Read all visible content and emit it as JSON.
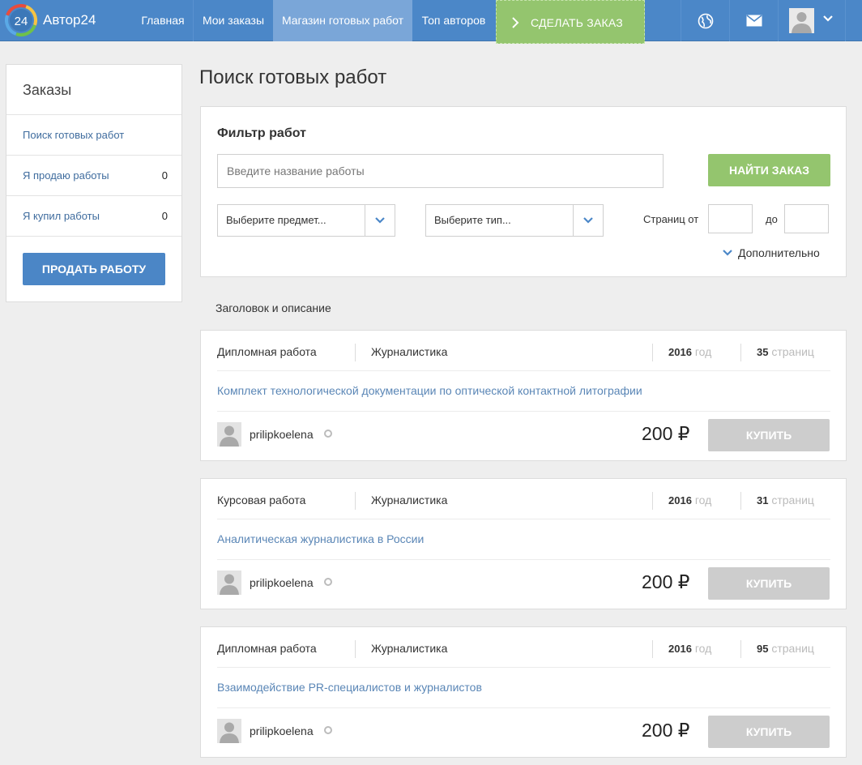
{
  "header": {
    "logo_number": "24",
    "brand": "Автор24",
    "nav": [
      {
        "label": "Главная",
        "active": false
      },
      {
        "label": "Мои заказы",
        "active": false
      },
      {
        "label": "Магазин готовых работ",
        "active": true
      },
      {
        "label": "Топ авторов",
        "active": false
      }
    ],
    "make_order_label": "СДЕЛАТЬ ЗАКАЗ",
    "icons": [
      "globe-icon",
      "mail-icon",
      "user-avatar",
      "chevron-down-icon"
    ]
  },
  "sidebar": {
    "title": "Заказы",
    "items": [
      {
        "label": "Поиск готовых работ",
        "count": ""
      },
      {
        "label": "Я продаю работы",
        "count": "0"
      },
      {
        "label": "Я купил работы",
        "count": "0"
      }
    ],
    "sell_button": "ПРОДАТЬ РАБОТУ"
  },
  "main": {
    "title": "Поиск готовых работ",
    "filter": {
      "title": "Фильтр работ",
      "search_placeholder": "Введите название работы",
      "find_button": "НАЙТИ ЗАКАЗ",
      "subject_select": "Выберите предмет...",
      "type_select": "Выберите тип...",
      "pages_from_label": "Страниц от",
      "pages_to_label": "до",
      "more_label": "Дополнительно"
    },
    "list_heading": "Заголовок и описание",
    "works": [
      {
        "type": "Дипломная работа",
        "subject": "Журналистика",
        "year": "2016",
        "year_suffix": "год",
        "pages": "35",
        "pages_suffix": "страниц",
        "title": "Комплект технологической документации по оптической контактной литографии",
        "author": "prilipkoelena",
        "price": "200 ₽",
        "buy_label": "КУПИТЬ"
      },
      {
        "type": "Курсовая работа",
        "subject": "Журналистика",
        "year": "2016",
        "year_suffix": "год",
        "pages": "31",
        "pages_suffix": "страниц",
        "title": "Аналитическая журналистика в России",
        "author": "prilipkoelena",
        "price": "200 ₽",
        "buy_label": "КУПИТЬ"
      },
      {
        "type": "Дипломная работа",
        "subject": "Журналистика",
        "year": "2016",
        "year_suffix": "год",
        "pages": "95",
        "pages_suffix": "страниц",
        "title": "Взаимодействие PR-специалистов и журналистов",
        "author": "prilipkoelena",
        "price": "200 ₽",
        "buy_label": "КУПИТЬ"
      }
    ]
  },
  "colors": {
    "header_blue": "#4b87c8",
    "active_tab": "#7aa6d8",
    "green_accent": "#94c56e",
    "link_blue": "#5a86b6",
    "disabled_gray": "#cdcdcd"
  }
}
